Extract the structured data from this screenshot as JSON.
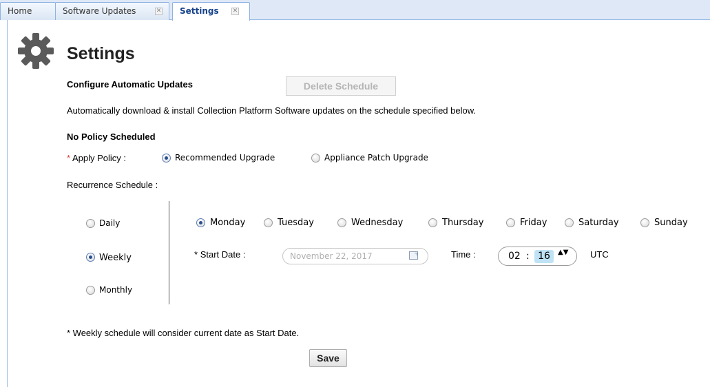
{
  "tabs": [
    {
      "label": "Home",
      "closable": false,
      "active": false
    },
    {
      "label": "Software Updates",
      "closable": true,
      "active": false
    },
    {
      "label": "Settings",
      "closable": true,
      "active": true
    }
  ],
  "tab_close_glyph": "✕",
  "icons": {
    "page_icon": "gear-icon",
    "date_picker": "calendar-icon",
    "time_spinner": "up-down-arrows-icon"
  },
  "colors": {
    "required_marker": "#e03a3a",
    "tab_bar": "#dfe8f6",
    "time_highlight": "#bfe3f5"
  },
  "page": {
    "title": "Settings",
    "section_title": "Configure Automatic Updates",
    "delete_schedule_label": "Delete Schedule",
    "description": "Automatically download & install Collection Platform Software updates on the schedule specified below.",
    "policy_status": "No Policy Scheduled",
    "required_marker": "*",
    "apply_policy_label": "Apply Policy :",
    "policy_options": [
      {
        "label": "Recommended Upgrade",
        "selected": true
      },
      {
        "label": "Appliance Patch Upgrade",
        "selected": false
      }
    ],
    "recurrence_label": "Recurrence Schedule :",
    "recurrence_options": [
      {
        "label": "Daily",
        "selected": false
      },
      {
        "label": "Weekly",
        "selected": true
      },
      {
        "label": "Monthly",
        "selected": false
      }
    ],
    "days": [
      {
        "label": "Monday",
        "selected": true
      },
      {
        "label": "Tuesday",
        "selected": false
      },
      {
        "label": "Wednesday",
        "selected": false
      },
      {
        "label": "Thursday",
        "selected": false
      },
      {
        "label": "Friday",
        "selected": false
      },
      {
        "label": "Saturday",
        "selected": false
      },
      {
        "label": "Sunday",
        "selected": false
      }
    ],
    "start_date_label": "Start Date :",
    "start_date_value": "November 22, 2017",
    "time_label": "Time :",
    "time_hour": "02",
    "time_separator": ":",
    "time_minute": "16",
    "spinner_glyph": "▲▼",
    "timezone": "UTC",
    "note": "* Weekly schedule will consider current date as Start Date.",
    "save_label": "Save"
  }
}
